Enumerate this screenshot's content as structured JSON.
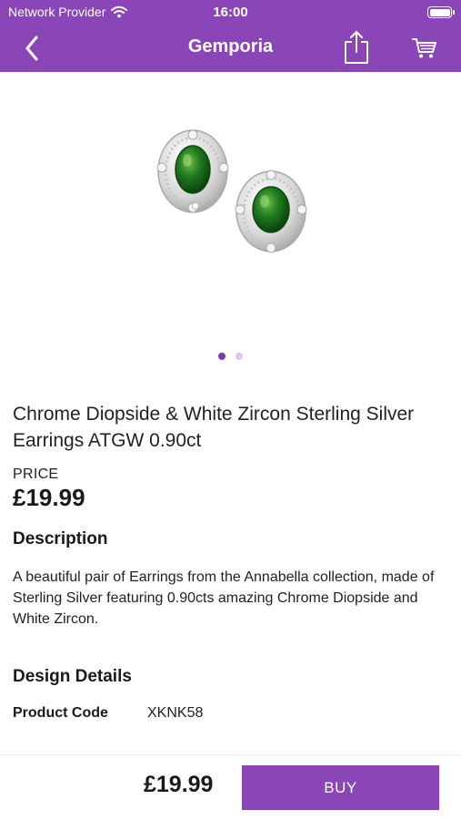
{
  "status_bar": {
    "carrier": "Network Provider",
    "time": "16:00"
  },
  "nav": {
    "title": "Gemporia",
    "icons": [
      "chevron-left-icon",
      "share-icon",
      "cart-icon"
    ]
  },
  "gallery": {
    "image": "chrome-diopside-earrings",
    "page_count": 2,
    "active_index": 0
  },
  "product": {
    "title": "Chrome Diopside & White Zircon Sterling Silver Earrings ATGW 0.90ct",
    "price_label": "PRICE",
    "price": "£19.99",
    "description_heading": "Description",
    "description": "A beautiful pair of Earrings from the Annabella collection, made of Sterling Silver featuring 0.90cts amazing Chrome Diopside and White Zircon.",
    "design_heading": "Design Details",
    "details": [
      {
        "label": "Product Code",
        "value": "XKNK58"
      }
    ]
  },
  "bottom_bar": {
    "price": "£19.99",
    "buy_label": "BUY"
  },
  "colors": {
    "brand_purple": "#8a45b7",
    "dot_active": "#7c3aad",
    "dot_inactive": "#dcc6ec"
  }
}
